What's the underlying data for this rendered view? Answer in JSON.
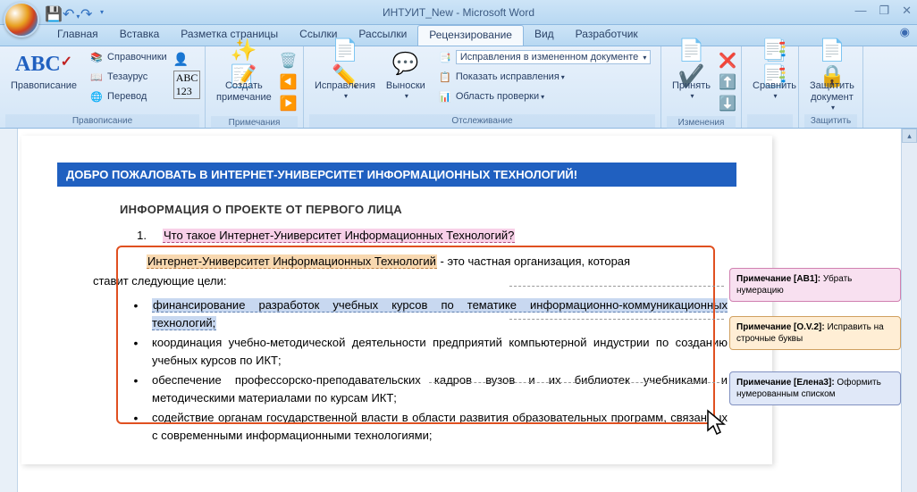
{
  "title": "ИНТУИТ_New - Microsoft Word",
  "tabs": {
    "home": "Главная",
    "insert": "Вставка",
    "layout": "Разметка страницы",
    "refs": "Ссылки",
    "mail": "Рассылки",
    "review": "Рецензирование",
    "view": "Вид",
    "dev": "Разработчик"
  },
  "ribbon": {
    "proofing": {
      "label": "Правописание",
      "spelling": "Правописание",
      "research": "Справочники",
      "thesaurus": "Тезаурус",
      "translate": "Перевод"
    },
    "comments": {
      "label": "Примечания",
      "new": "Создать\nпримечание"
    },
    "tracking": {
      "label": "Отслеживание",
      "track": "Исправления",
      "balloons": "Выноски",
      "display": "Исправления в измененном документе",
      "show": "Показать исправления",
      "pane": "Область проверки"
    },
    "changes": {
      "label": "Изменения",
      "accept": "Принять"
    },
    "compare": {
      "label": "",
      "compare": "Сравнить"
    },
    "protect": {
      "label": "Защитить",
      "protect": "Защитить\nдокумент"
    }
  },
  "doc": {
    "banner": "ДОБРО ПОЖАЛОВАТЬ В ИНТЕРНЕТ-УНИВЕРСИТЕТ ИНФОРМАЦИОННЫХ ТЕХНОЛОГИЙ!",
    "heading": "ИНФОРМАЦИЯ О ПРОЕКТЕ ОТ ПЕРВОГО ЛИЦА",
    "item1_num": "1.",
    "item1_hl": "Что такое Интернет-Университет Информационных Технологий?",
    "para_hl": "Интернет-Университет Информационных Технологий",
    "para_rest": " - это частная организация, которая",
    "para_cont": "ставит следующие цели:",
    "b1_hl": "финансирование разработок учебных курсов по тематике информационно-коммуникационных технологий;",
    "b2": "координация учебно-методической деятельности предприятий компьютерной индустрии по созданию учебных курсов по ИКТ;",
    "b3": "обеспечение профессорско-преподавательских кадров вузов и их библиотек учебниками и методическими материалами по курсам ИКТ;",
    "b4": "содействие органам государственной власти в области развития образовательных программ, связанных с современными информационными технологиями;"
  },
  "comments": {
    "c1_label": "Примечание [AB1]:",
    "c1_text": " Убрать нумерацию",
    "c2_label": "Примечание [O.V.2]:",
    "c2_text": " Исправить на строчные буквы",
    "c3_label": "Примечание [Елена3]:",
    "c3_text": " Оформить нумерованным списком"
  }
}
